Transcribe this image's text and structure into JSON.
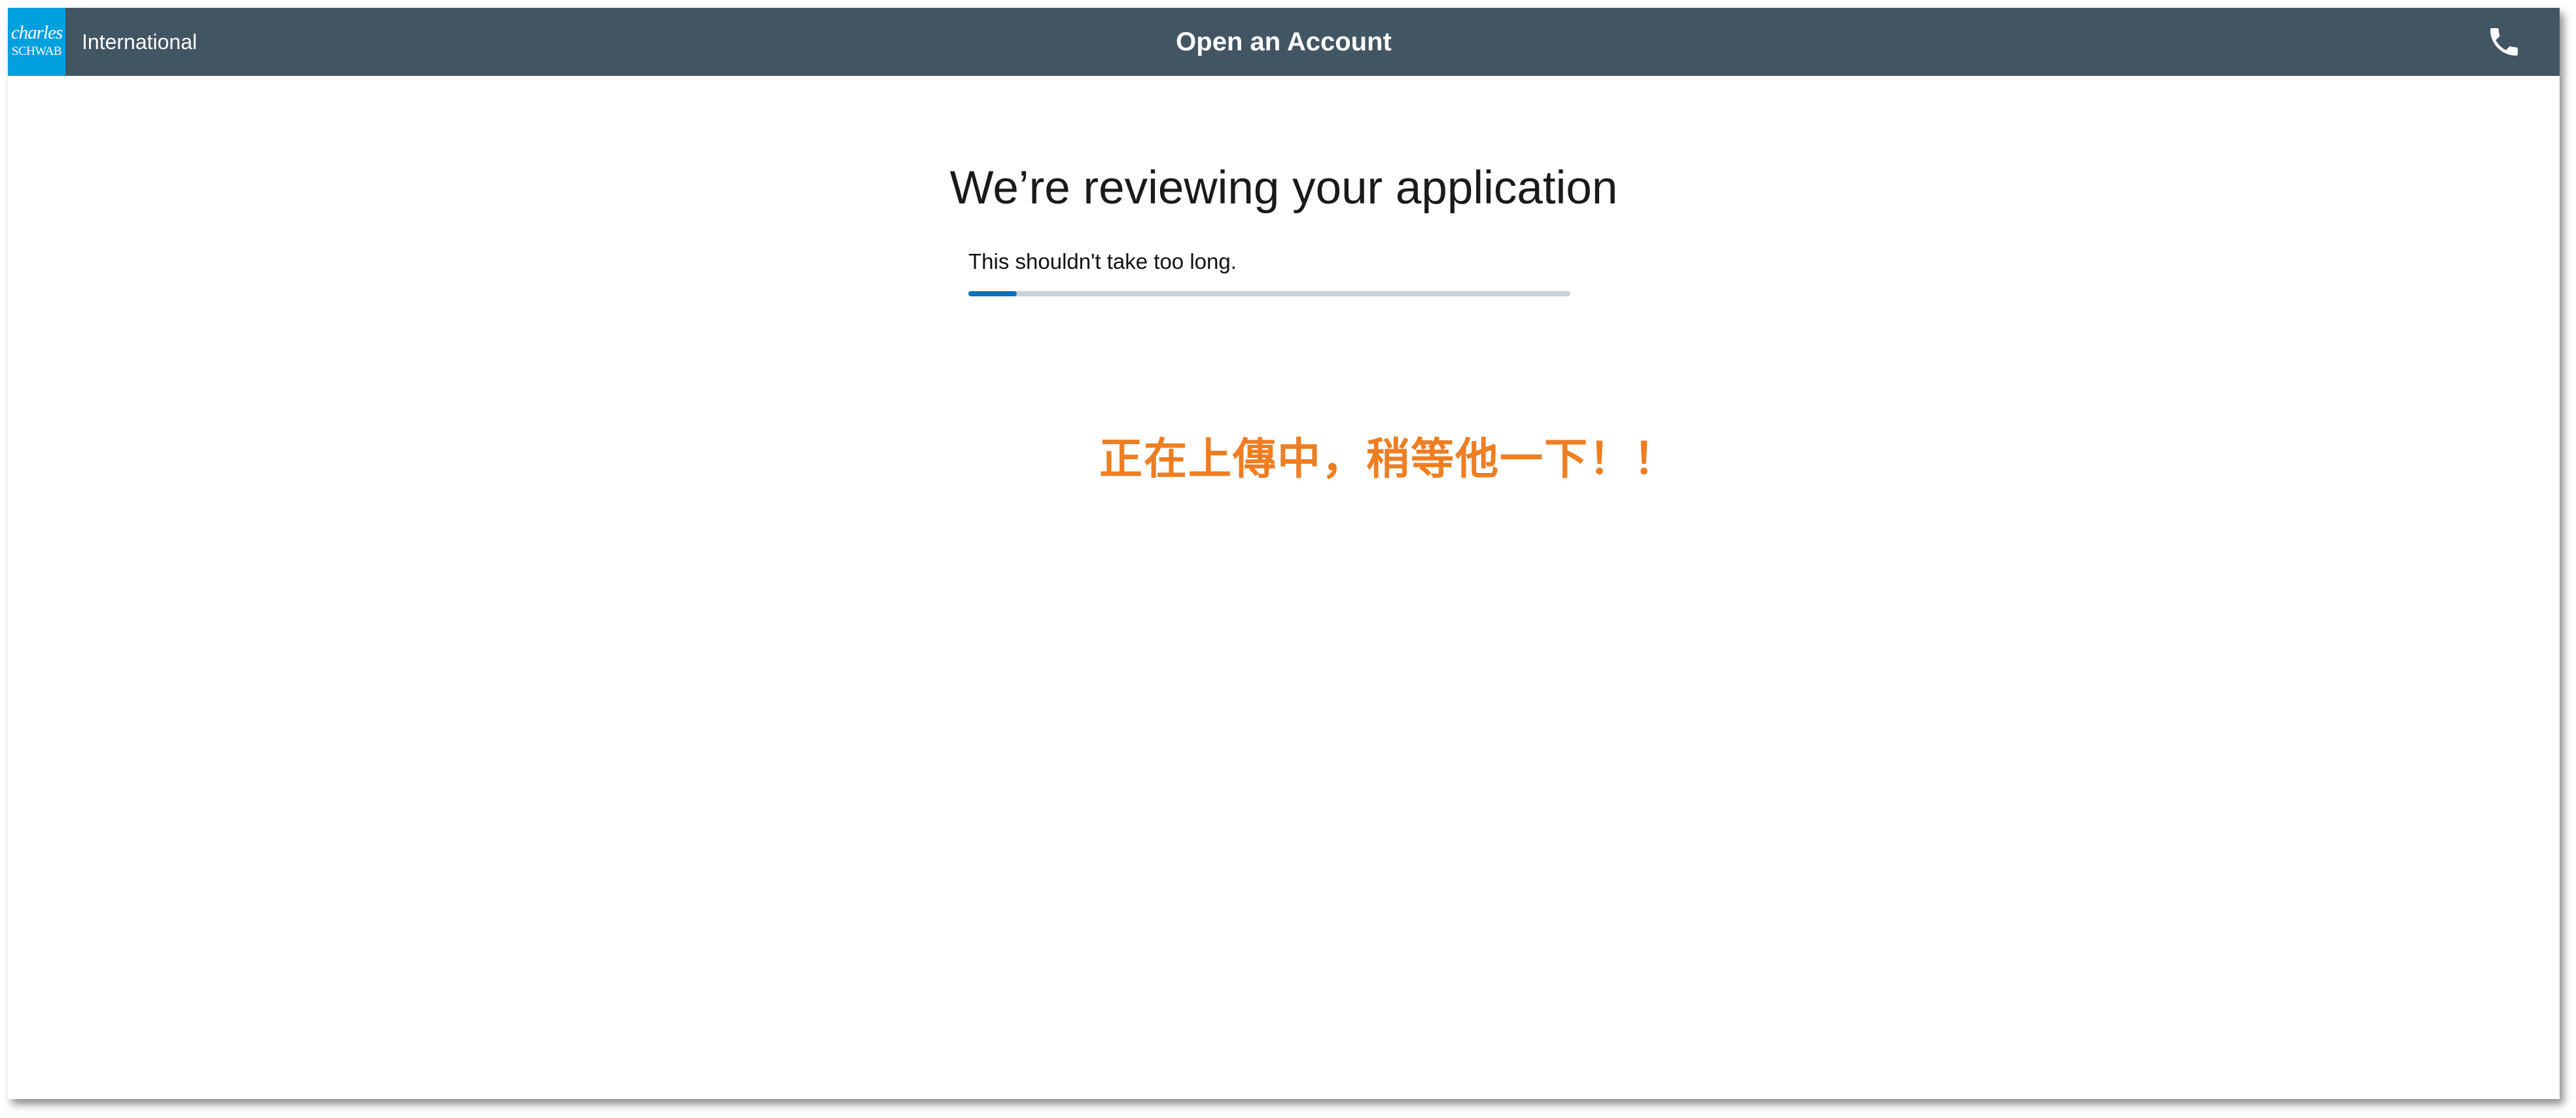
{
  "header": {
    "logo_top": "charles",
    "logo_bottom": "SCHWAB",
    "brand_sub": "International",
    "title": "Open an Account",
    "phone_icon": "phone-icon"
  },
  "main": {
    "title": "We’re reviewing your application",
    "subtext": "This shouldn't take too long.",
    "progress_percent": 8
  },
  "annotation": {
    "text": "正在上傳中，稍等他一下！！"
  },
  "colors": {
    "header_bg": "#425563",
    "logo_bg": "#00a0df",
    "progress_fill": "#0d72b9",
    "progress_track": "#c8d2da",
    "annotation": "#ef7d22"
  }
}
